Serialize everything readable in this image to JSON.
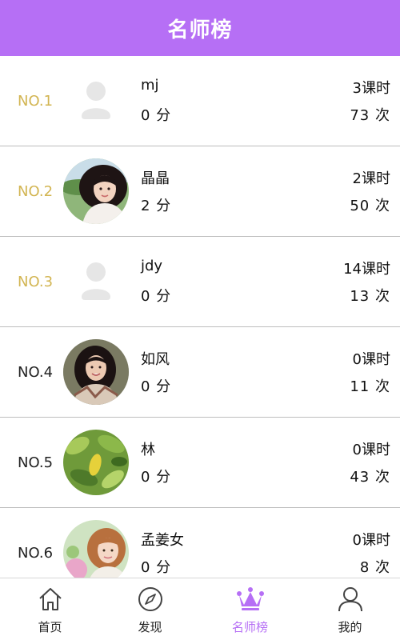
{
  "header": {
    "title": "名师榜"
  },
  "teachers": [
    {
      "rank": "NO.1",
      "name": "mj",
      "score": "0 分",
      "hours": "3课时",
      "times": "73 次",
      "avatar": "placeholder"
    },
    {
      "rank": "NO.2",
      "name": "晶晶",
      "score": "2 分",
      "hours": "2课时",
      "times": "50 次",
      "avatar": "photo"
    },
    {
      "rank": "NO.3",
      "name": "jdy",
      "score": "0 分",
      "hours": "14课时",
      "times": "13 次",
      "avatar": "placeholder"
    },
    {
      "rank": "NO.4",
      "name": "如风",
      "score": "0 分",
      "hours": "0课时",
      "times": "11 次",
      "avatar": "photo"
    },
    {
      "rank": "NO.5",
      "name": "林",
      "score": "0 分",
      "hours": "0课时",
      "times": "43 次",
      "avatar": "photo"
    },
    {
      "rank": "NO.6",
      "name": "孟姜女",
      "score": "0 分",
      "hours": "0课时",
      "times": "8 次",
      "avatar": "photo"
    }
  ],
  "tabs": [
    {
      "label": "首页",
      "icon": "home-icon"
    },
    {
      "label": "发现",
      "icon": "compass-icon"
    },
    {
      "label": "名师榜",
      "icon": "crown-icon",
      "active": true
    },
    {
      "label": "我的",
      "icon": "person-icon"
    }
  ],
  "colors": {
    "accent": "#b66ff5",
    "gold_rank": "#d2b552"
  }
}
